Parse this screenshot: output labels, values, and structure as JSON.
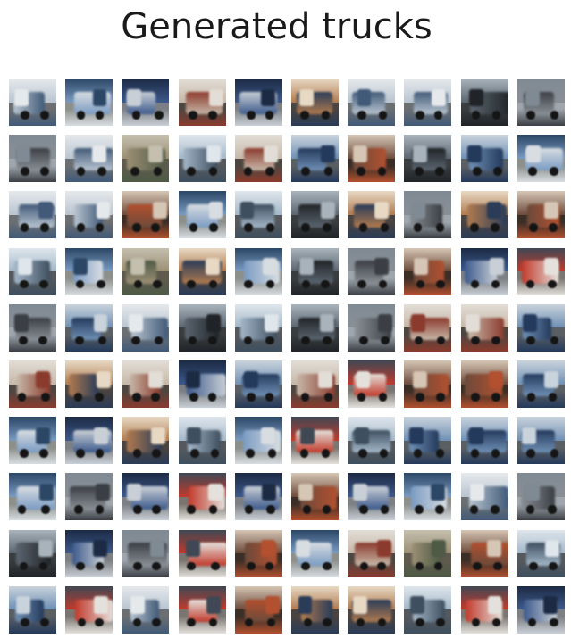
{
  "title": "Generated trucks",
  "image_grid": {
    "rows": 10,
    "cols": 10,
    "subject": "blurry generated truck images",
    "palettes": [
      [
        "#8a8f96",
        "#3b3f45",
        "#7f8a94",
        "#9fa6ad"
      ],
      [
        "#6e8fb4",
        "#243a5c",
        "#c9d3dc",
        "#5a5f63"
      ],
      [
        "#c7b8a8",
        "#8b3b2e",
        "#e2ddd6",
        "#4d4640"
      ],
      [
        "#5b6570",
        "#202428",
        "#a9b3bc",
        "#3a3d3f"
      ],
      [
        "#7a9bc2",
        "#d8dde2",
        "#2c4766",
        "#8c8f8a"
      ],
      [
        "#b8c4d0",
        "#415a78",
        "#e6e9ec",
        "#6b6f72"
      ],
      [
        "#3d5a8c",
        "#c9cfd6",
        "#1c2a44",
        "#7c7f83"
      ],
      [
        "#9c8f74",
        "#4e5a46",
        "#c4bfae",
        "#5f5a4d"
      ],
      [
        "#6c4a3a",
        "#b2502f",
        "#d6c6b5",
        "#3a2e26"
      ],
      [
        "#a3b7c9",
        "#3e4f5f",
        "#dfe6ec",
        "#55595d"
      ],
      [
        "#b07a4f",
        "#2a3c58",
        "#e7d9c4",
        "#4a4440"
      ],
      [
        "#c23a2c",
        "#e4e1dc",
        "#3f4854",
        "#7a7570"
      ]
    ]
  }
}
